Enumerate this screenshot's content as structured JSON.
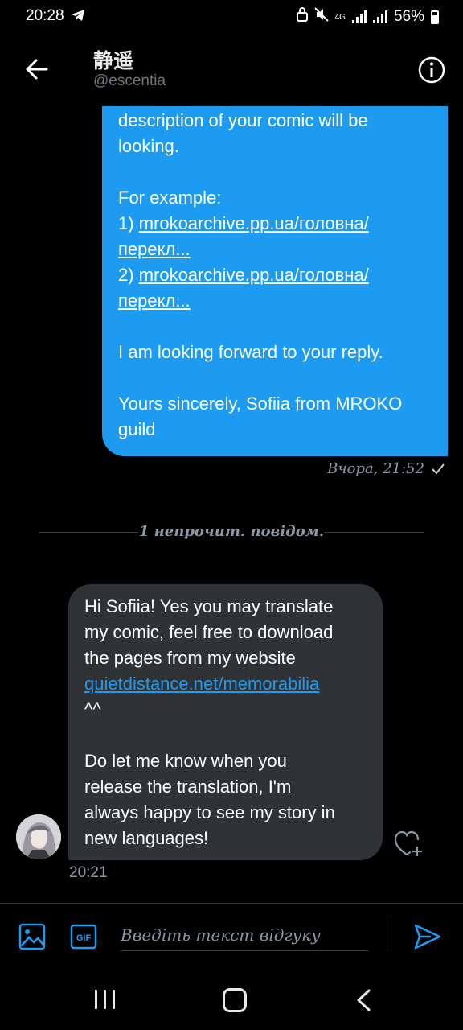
{
  "status_bar": {
    "time": "20:28",
    "network": "4G",
    "battery": "56%"
  },
  "header": {
    "name": "静遥",
    "handle": "@escentia"
  },
  "outgoing": {
    "lines": [
      "description of your comic will be",
      "looking.",
      "For example:",
      "I am looking forward to your reply.",
      "Yours sincerely, Sofiia from MROKO",
      "guild"
    ],
    "example_1_prefix": "1) ",
    "example_1_link_a": "mrokoarchive.pp.ua/головна/",
    "example_1_link_b": "перекл...",
    "example_2_prefix": "2) ",
    "example_2_link_a": "mrokoarchive.pp.ua/головна/",
    "example_2_link_b": "перекл...",
    "timestamp": "Вчора, 21:52"
  },
  "divider": {
    "text": "1 непрочит. повідом."
  },
  "incoming": {
    "lines": [
      "Hi Sofiia! Yes you may translate",
      "my comic, feel free to download",
      "the pages from my website",
      "^^",
      "Do let me know when you",
      "release the translation, I'm",
      "always happy to see my story in",
      "new languages!"
    ],
    "link": "quietdistance.net/memorabilia",
    "timestamp": "20:21"
  },
  "composer": {
    "placeholder": "Введіть текст відгуку"
  },
  "colors": {
    "accent": "#1d9bf0",
    "incoming_bubble": "#2f3336",
    "background": "#000000",
    "muted_text": "#8b98a5"
  },
  "icons": [
    "telegram-icon",
    "back-arrow-icon",
    "info-icon",
    "check-icon",
    "heart-plus-icon",
    "image-icon",
    "gif-icon",
    "send-icon"
  ]
}
